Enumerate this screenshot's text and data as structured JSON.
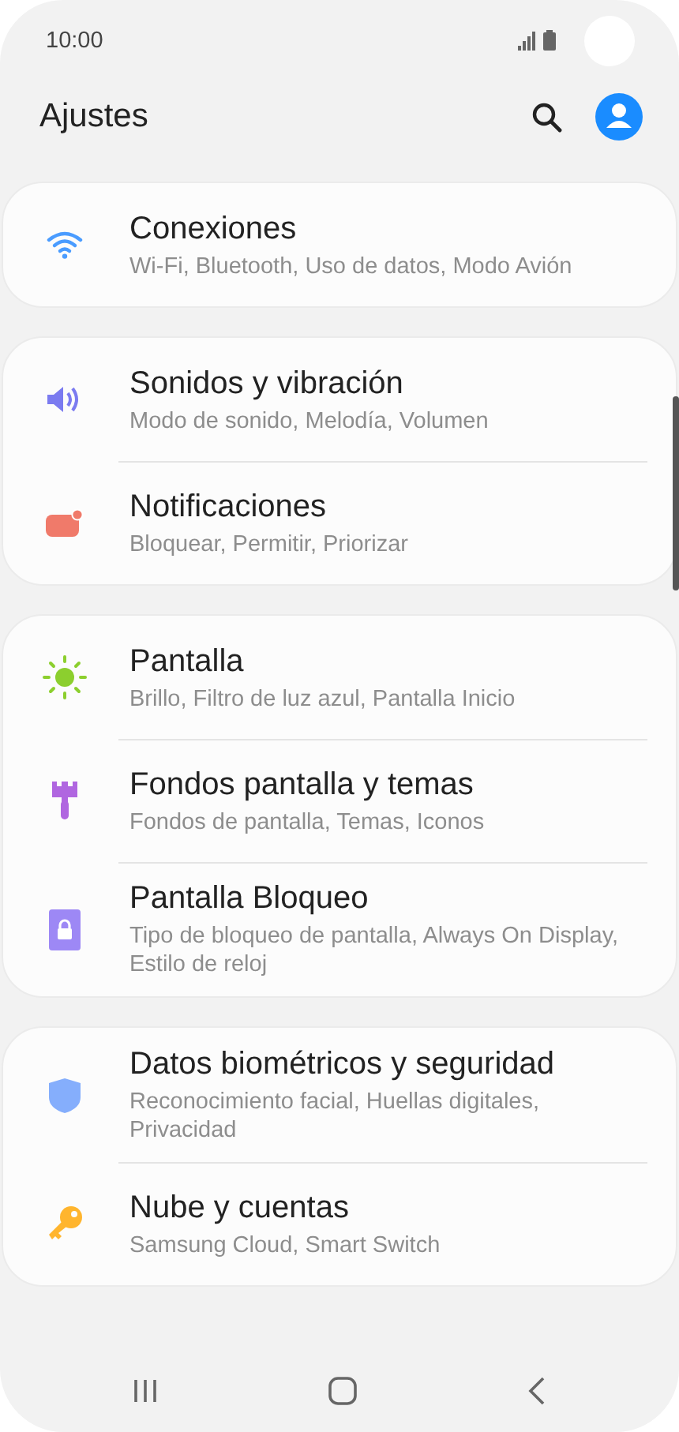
{
  "status_bar": {
    "time": "10:00"
  },
  "header": {
    "title": "Ajustes"
  },
  "groups": [
    {
      "items": [
        {
          "kind": "wifi",
          "title": "Conexiones",
          "subtitle": "Wi-Fi, Bluetooth, Uso de datos, Modo Avión"
        }
      ]
    },
    {
      "items": [
        {
          "kind": "sound",
          "title": "Sonidos y vibración",
          "subtitle": "Modo de sonido, Melodía, Volumen"
        },
        {
          "kind": "notification",
          "title": "Notificaciones",
          "subtitle": "Bloquear, Permitir, Priorizar"
        }
      ]
    },
    {
      "items": [
        {
          "kind": "brightness",
          "title": "Pantalla",
          "subtitle": "Brillo, Filtro de luz azul, Pantalla Inicio"
        },
        {
          "kind": "brush",
          "title": "Fondos pantalla y temas",
          "subtitle": "Fondos de pantalla, Temas, Iconos"
        },
        {
          "kind": "lock",
          "title": "Pantalla Bloqueo",
          "subtitle": "Tipo de bloqueo de pantalla, Always On Display, Estilo de reloj"
        }
      ]
    },
    {
      "items": [
        {
          "kind": "shield",
          "title": "Datos biométricos y seguridad",
          "subtitle": "Reconocimiento facial, Huellas digitales, Privacidad"
        },
        {
          "kind": "key",
          "title": "Nube y cuentas",
          "subtitle": "Samsung Cloud, Smart Switch"
        }
      ]
    }
  ]
}
